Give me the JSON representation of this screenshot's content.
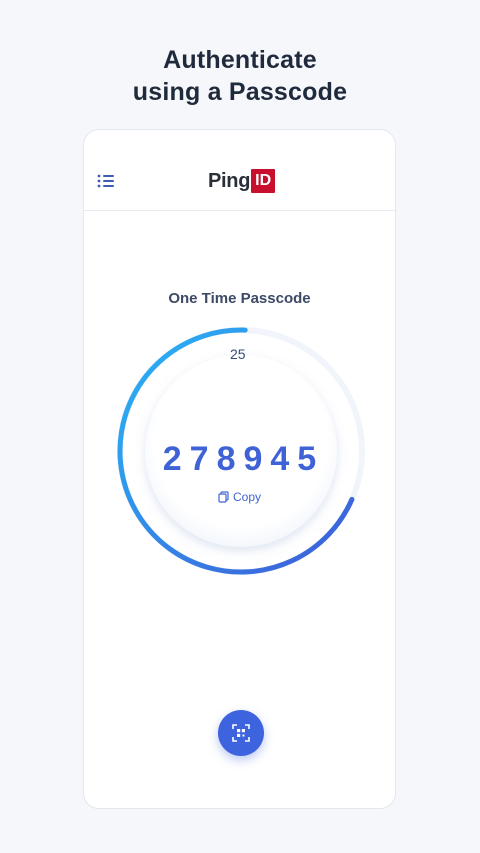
{
  "headline": {
    "line1": "Authenticate",
    "line2": "using a Passcode"
  },
  "header": {
    "logo_text": "Ping",
    "logo_badge": "ID",
    "menu_icon": "list-icon"
  },
  "otp": {
    "title": "One Time Passcode",
    "seconds_remaining": "25",
    "code": "278945",
    "copy_label": "Copy",
    "copy_icon": "copy-icon",
    "progress_fraction": 0.69
  },
  "scan_button": {
    "icon": "qr-scan-icon"
  },
  "colors": {
    "accent": "#3e63df",
    "ring_start": "#29b6f6",
    "ring_end": "#3e5bd8",
    "logo_red": "#c8102e",
    "background": "#f5f7fb"
  }
}
